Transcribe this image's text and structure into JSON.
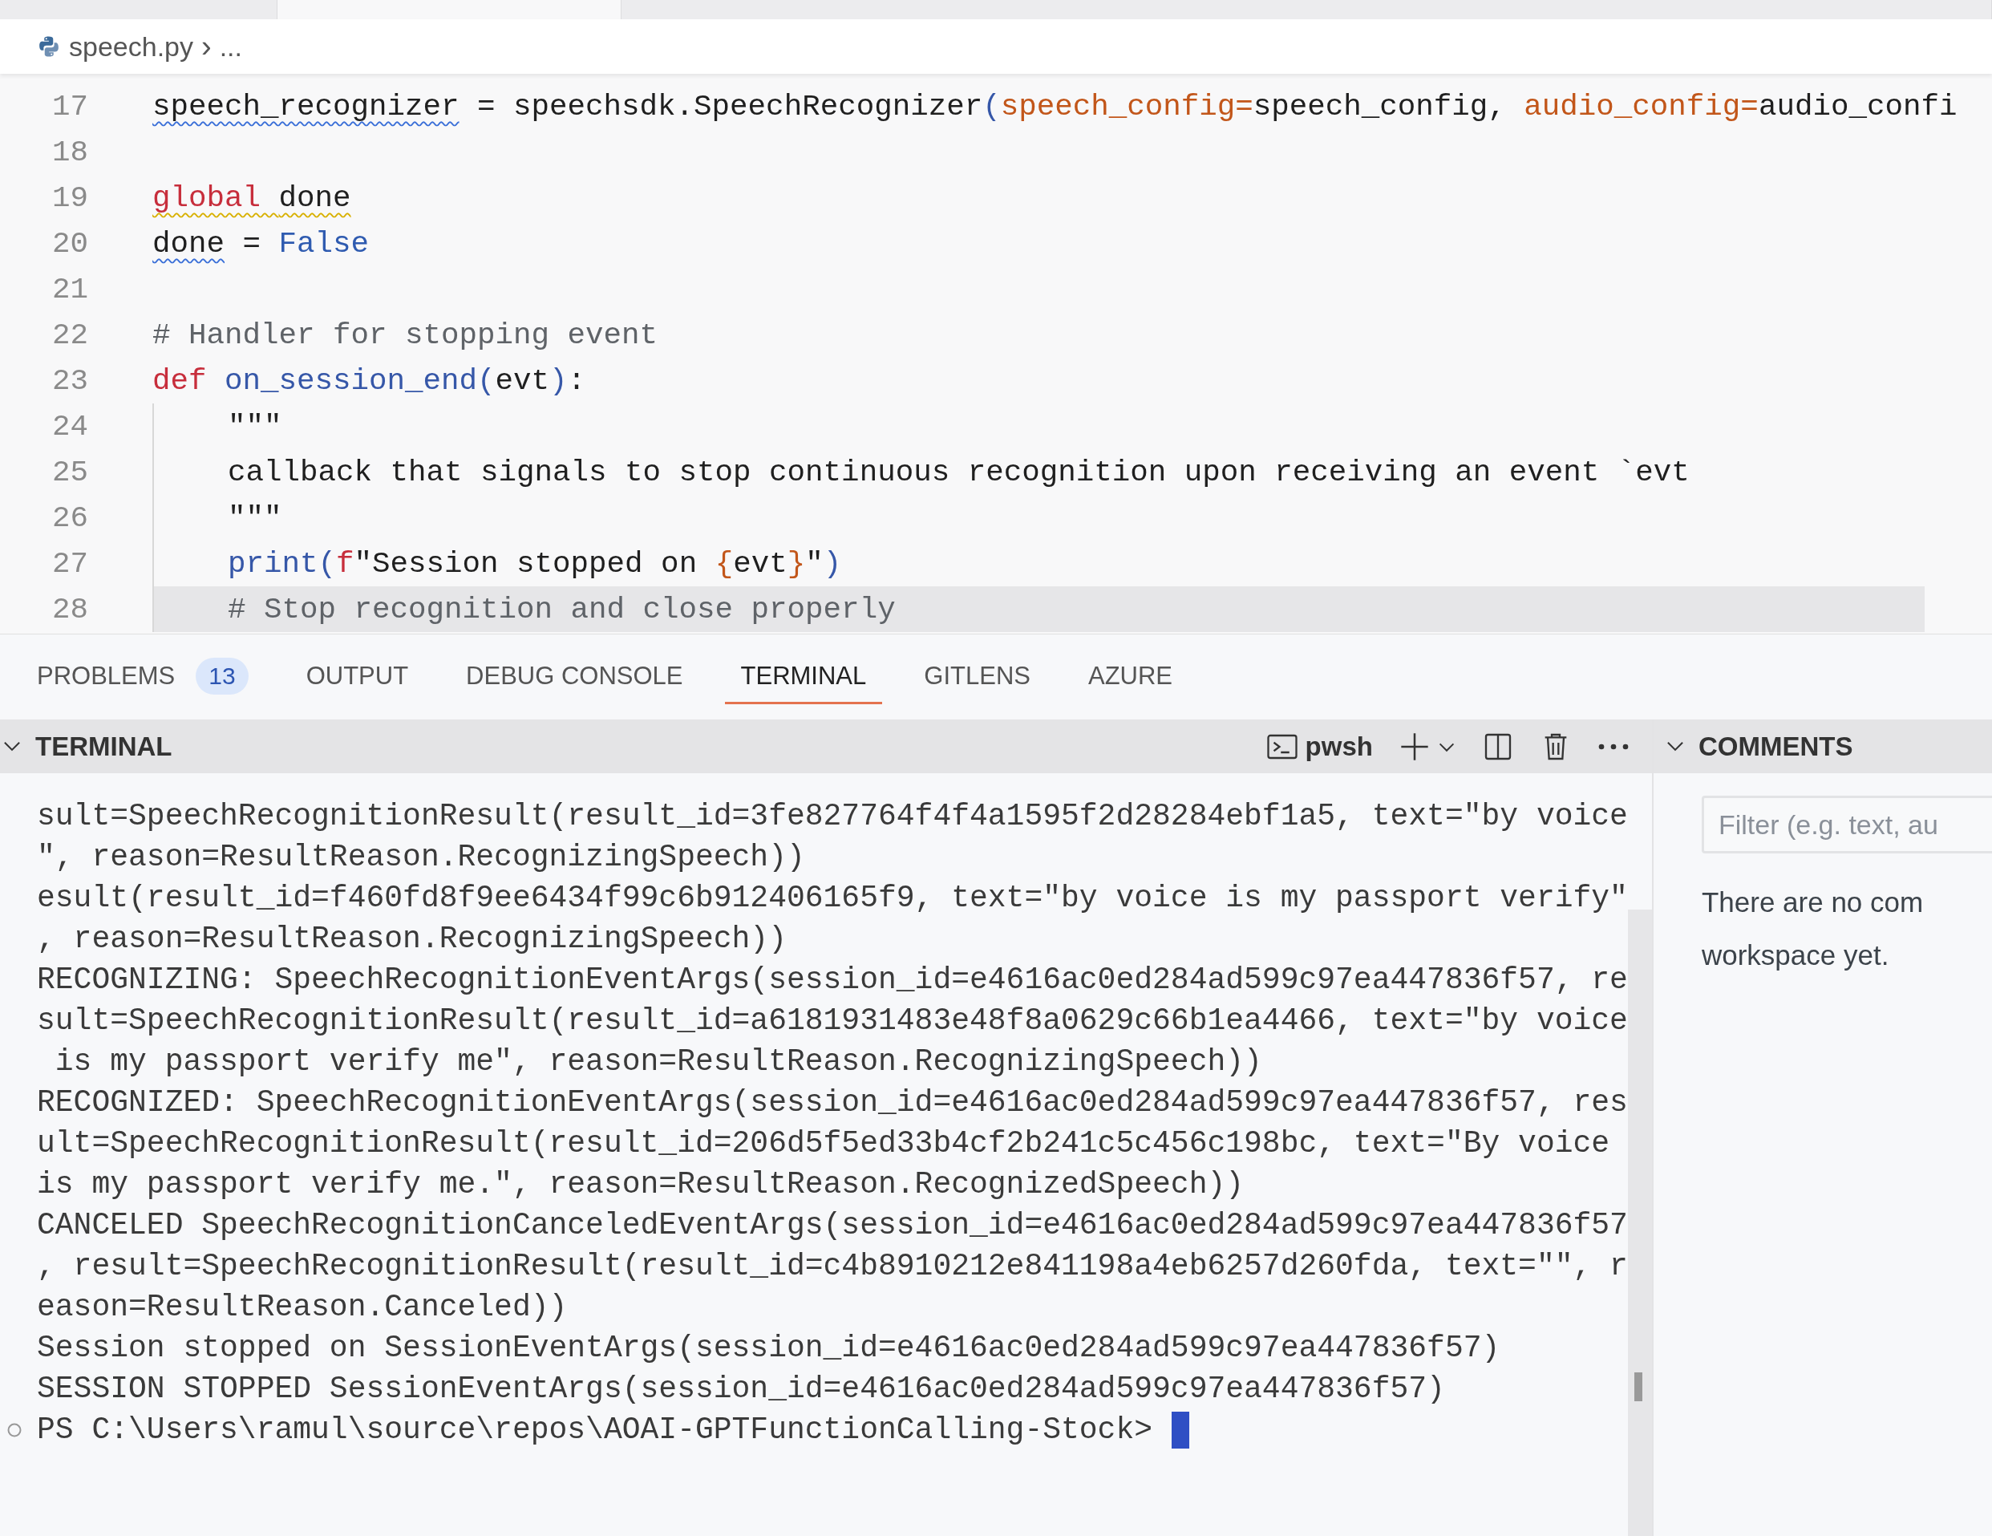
{
  "editor_tabs": [
    {
      "selected": false
    },
    {
      "selected": true
    },
    {
      "selected": false
    }
  ],
  "breadcrumb": {
    "file": "speech.py",
    "separator": "›",
    "rest": "..."
  },
  "code_lines": [
    {
      "number": "17",
      "indented": false,
      "current": false,
      "tokens": [
        {
          "text": "speech_recognizer",
          "kind": "plain",
          "info_squiggle": true,
          "warning_squiggle": false
        },
        {
          "text": " = speechsdk.SpeechRecognizer",
          "kind": "plain"
        },
        {
          "text": "(",
          "kind": "bracket"
        },
        {
          "text": "speech_config=",
          "kind": "param"
        },
        {
          "text": "speech_config, ",
          "kind": "plain"
        },
        {
          "text": "audio_config=",
          "kind": "param"
        },
        {
          "text": "audio_confi",
          "kind": "plain"
        }
      ]
    },
    {
      "number": "18",
      "indented": false,
      "current": false
    },
    {
      "number": "19",
      "indented": false,
      "current": false,
      "tokens": [
        {
          "text": "global ",
          "kind": "keyword",
          "info_squiggle": false,
          "warning_squiggle": true
        },
        {
          "text": "done",
          "kind": "plain",
          "info_squiggle": false,
          "warning_squiggle": true
        }
      ]
    },
    {
      "number": "20",
      "indented": false,
      "current": false,
      "tokens": [
        {
          "text": "done",
          "kind": "plain",
          "info_squiggle": true,
          "warning_squiggle": false
        },
        {
          "text": " = ",
          "kind": "plain"
        },
        {
          "text": "False",
          "kind": "constant"
        }
      ]
    },
    {
      "number": "21",
      "indented": false,
      "current": false
    },
    {
      "number": "22",
      "indented": false,
      "current": false,
      "tokens": [
        {
          "text": "# Handler for stopping event",
          "kind": "comment"
        }
      ]
    },
    {
      "number": "23",
      "indented": false,
      "current": false,
      "tokens": [
        {
          "text": "def ",
          "kind": "keyword"
        },
        {
          "text": "on_session_end",
          "kind": "function"
        },
        {
          "text": "(",
          "kind": "bracket"
        },
        {
          "text": "evt",
          "kind": "plain"
        },
        {
          "text": ")",
          "kind": "bracket"
        },
        {
          "text": ":",
          "kind": "plain"
        }
      ]
    },
    {
      "number": "24",
      "indented": true,
      "current": false,
      "tokens": [
        {
          "text": "\"\"\"",
          "kind": "docstring"
        }
      ]
    },
    {
      "number": "25",
      "indented": true,
      "current": false,
      "tokens": [
        {
          "text": "callback that signals to stop continuous recognition upon receiving an event `evt",
          "kind": "docstring"
        }
      ]
    },
    {
      "number": "26",
      "indented": true,
      "current": false,
      "tokens": [
        {
          "text": "\"\"\"",
          "kind": "docstring"
        }
      ]
    },
    {
      "number": "27",
      "indented": true,
      "current": false,
      "tokens": [
        {
          "text": "print",
          "kind": "function"
        },
        {
          "text": "(",
          "kind": "bracket"
        },
        {
          "text": "f",
          "kind": "keyword"
        },
        {
          "text": "\"Session stopped on ",
          "kind": "docstring"
        },
        {
          "text": "{",
          "kind": "param"
        },
        {
          "text": "evt",
          "kind": "plain"
        },
        {
          "text": "}",
          "kind": "param"
        },
        {
          "text": "\"",
          "kind": "docstring"
        },
        {
          "text": ")",
          "kind": "bracket"
        }
      ]
    },
    {
      "number": "28",
      "indented": true,
      "current": true,
      "tokens": [
        {
          "text": "# Stop recognition and close properly",
          "kind": "comment"
        }
      ]
    }
  ],
  "panel_tabs": [
    {
      "label": "PROBLEMS",
      "badge": "13",
      "selected": false
    },
    {
      "label": "OUTPUT",
      "selected": false
    },
    {
      "label": "DEBUG CONSOLE",
      "selected": false
    },
    {
      "label": "TERMINAL",
      "selected": true
    },
    {
      "label": "GITLENS",
      "selected": false
    },
    {
      "label": "AZURE",
      "selected": false
    }
  ],
  "terminal": {
    "title": "TERMINAL",
    "shell": "pwsh",
    "lines": [
      "sult=SpeechRecognitionResult(result_id=3fe827764f4f4a1595f2d28284ebf1a5, text=\"by voice",
      "\", reason=ResultReason.RecognizingSpeech))",
      "esult(result_id=f460fd8f9ee6434f99c6b912406165f9, text=\"by voice is my passport verify\"",
      ", reason=ResultReason.RecognizingSpeech))",
      "RECOGNIZING: SpeechRecognitionEventArgs(session_id=e4616ac0ed284ad599c97ea447836f57, re",
      "sult=SpeechRecognitionResult(result_id=a6181931483e48f8a0629c66b1ea4466, text=\"by voice",
      " is my passport verify me\", reason=ResultReason.RecognizingSpeech))",
      "RECOGNIZED: SpeechRecognitionEventArgs(session_id=e4616ac0ed284ad599c97ea447836f57, res",
      "ult=SpeechRecognitionResult(result_id=206d5f5ed33b4cf2b241c5c456c198bc, text=\"By voice",
      "is my passport verify me.\", reason=ResultReason.RecognizedSpeech))",
      "CANCELED SpeechRecognitionCanceledEventArgs(session_id=e4616ac0ed284ad599c97ea447836f57",
      ", result=SpeechRecognitionResult(result_id=c4b8910212e841198a4eb6257d260fda, text=\"\", r",
      "eason=ResultReason.Canceled))",
      "Session stopped on SessionEventArgs(session_id=e4616ac0ed284ad599c97ea447836f57)",
      "SESSION STOPPED SessionEventArgs(session_id=e4616ac0ed284ad599c97ea447836f57)"
    ],
    "prompt": "PS C:\\Users\\ramul\\source\\repos\\AOAI-GPTFunctionCalling-Stock>"
  },
  "comments": {
    "title": "COMMENTS",
    "filter_placeholder": "Filter (e.g. text, au",
    "message_lines": [
      "There are no com",
      "workspace yet."
    ]
  }
}
